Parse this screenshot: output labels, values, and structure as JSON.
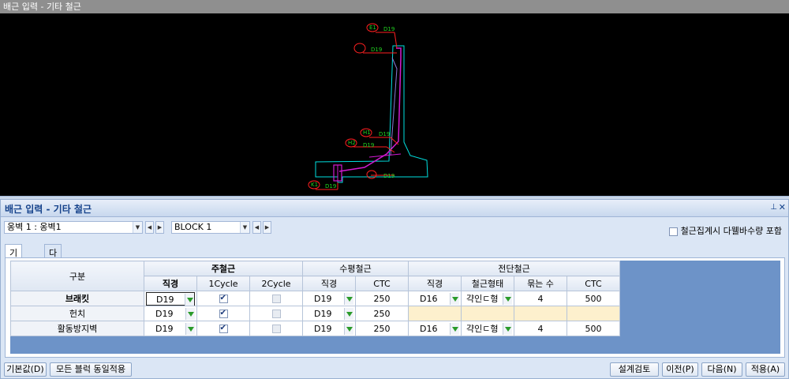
{
  "window_title": "배근 입력 - 기타 철근",
  "cad": {
    "labels": [
      "E1",
      "D19",
      "D19",
      "H1",
      "D19",
      "H2",
      "D19",
      "D19",
      "K1",
      "D19"
    ],
    "colors": {
      "concrete": "#00e0e0",
      "rebar": "#d21ad2",
      "leader": "#ff2020",
      "text": "#21d321"
    }
  },
  "panel": {
    "title": "배근 입력 - 기타 철근",
    "pin_icon": "pin-icon",
    "close_icon": "close-icon",
    "wall_select": "옹벽 1 : 옹벽1",
    "block_select": "BLOCK  1",
    "include_checkbox_label": "철근집계시 다웰바수량 포함",
    "include_checkbox_checked": false
  },
  "tabs": [
    {
      "label": "기타철근",
      "active": true
    },
    {
      "label": "다웰바",
      "active": false
    }
  ],
  "grid": {
    "header": {
      "category": "구분",
      "main": "주철근",
      "horizontal": "수평철근",
      "shear": "전단철근",
      "diameter": "직경",
      "cycle1": "1Cycle",
      "cycle2": "2Cycle",
      "ctc": "CTC",
      "shape": "철근형태",
      "bundle": "묶는 수"
    },
    "rows": [
      {
        "name": "브래킷",
        "main_dia": "D19",
        "cycle1": true,
        "cycle2": false,
        "h_dia": "D19",
        "h_ctc": "250",
        "s_dia": "D16",
        "s_shape": "갹인ㄷ형",
        "s_bundle": "4",
        "s_ctc": "500",
        "shear_enabled": true
      },
      {
        "name": "헌치",
        "main_dia": "D19",
        "cycle1": true,
        "cycle2": false,
        "h_dia": "D19",
        "h_ctc": "250",
        "s_dia": "",
        "s_shape": "",
        "s_bundle": "",
        "s_ctc": "",
        "shear_enabled": false
      },
      {
        "name": "활동방지벽",
        "main_dia": "D19",
        "cycle1": true,
        "cycle2": false,
        "h_dia": "D19",
        "h_ctc": "250",
        "s_dia": "D16",
        "s_shape": "갹인ㄷ형",
        "s_bundle": "4",
        "s_ctc": "500",
        "shear_enabled": true
      }
    ]
  },
  "buttons": {
    "defaults": "기본값(D)",
    "apply_all_blocks": "모든 블럭 동일적용",
    "design_check": "설계검토",
    "prev": "이전(P)",
    "next": "다음(N)",
    "apply": "적용(A)"
  }
}
